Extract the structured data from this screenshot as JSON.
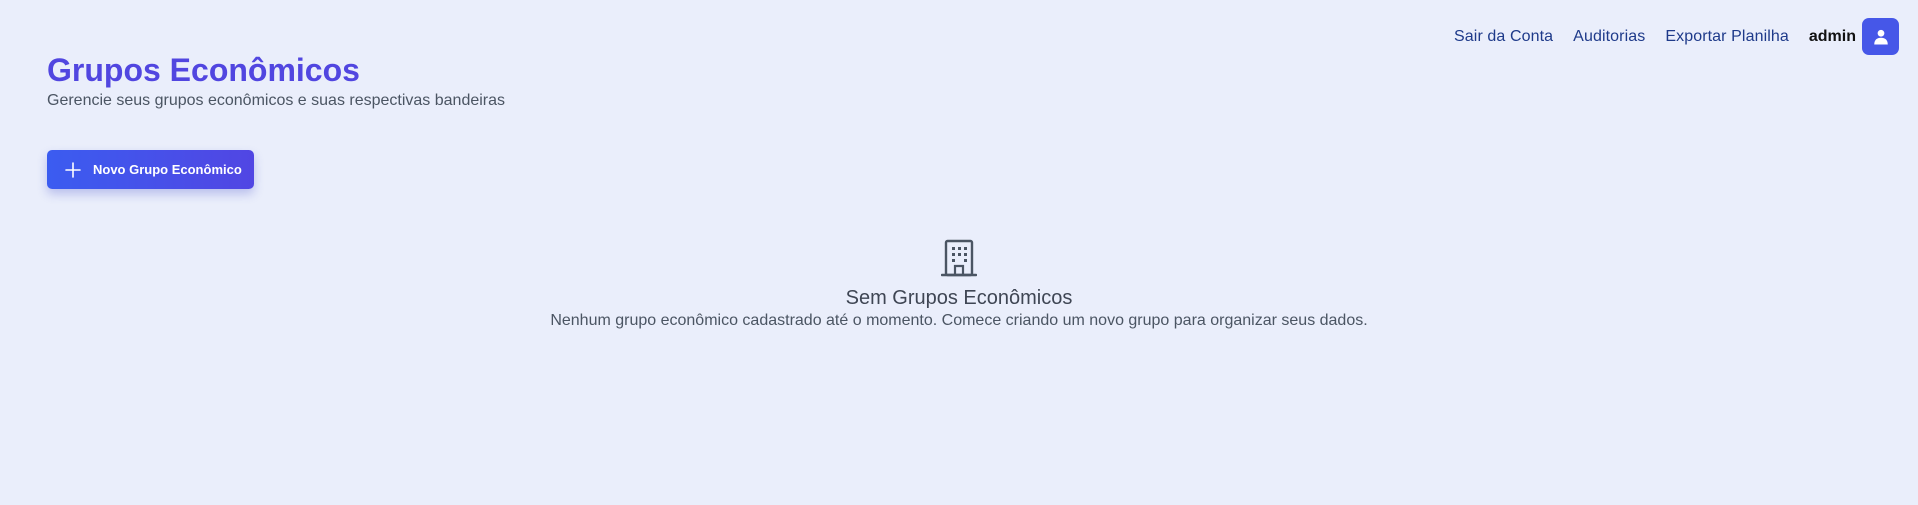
{
  "nav": {
    "logout_label": "Sair da Conta",
    "audits_label": "Auditorias",
    "export_label": "Exportar Planilha",
    "username": "admin",
    "avatar_icon": "user-icon"
  },
  "header": {
    "title": "Grupos Econômicos",
    "subtitle": "Gerencie seus grupos econômicos e suas respectivas bandeiras"
  },
  "actions": {
    "new_group_label": "Novo Grupo Econômico",
    "new_group_icon": "plus-icon"
  },
  "empty_state": {
    "icon": "building-icon",
    "title": "Sem Grupos Econômicos",
    "description": "Nenhum grupo econômico cadastrado até o momento. Comece criando um novo grupo para organizar seus dados."
  },
  "colors": {
    "background": "#eaeefb",
    "accent": "#5146e0",
    "nav_link": "#1e3a8a",
    "button_gradient_start": "#3b5cf0",
    "button_gradient_end": "#5146e3"
  }
}
